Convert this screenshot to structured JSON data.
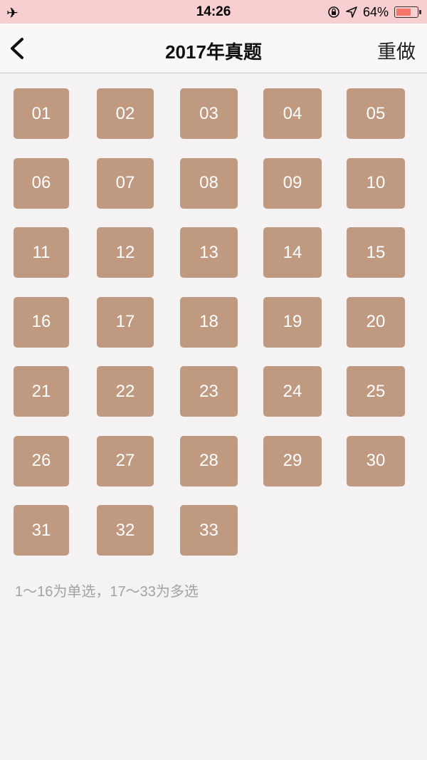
{
  "status_bar": {
    "time": "14:26",
    "battery_percent": "64%",
    "battery_level": 0.64,
    "icons": [
      "airplane-icon",
      "orientation-lock-icon",
      "location-arrow-icon",
      "battery-icon"
    ]
  },
  "nav": {
    "title": "2017年真题",
    "back_icon": "chevron-left-icon",
    "redo_label": "重做"
  },
  "questions": [
    "01",
    "02",
    "03",
    "04",
    "05",
    "06",
    "07",
    "08",
    "09",
    "10",
    "11",
    "12",
    "13",
    "14",
    "15",
    "16",
    "17",
    "18",
    "19",
    "20",
    "21",
    "22",
    "23",
    "24",
    "25",
    "26",
    "27",
    "28",
    "29",
    "30",
    "31",
    "32",
    "33"
  ],
  "note": "1～16为单选，17～33为多选",
  "colors": {
    "status_bar": "#f8cfd0",
    "question_button": "#c09a80",
    "background": "#f4f2f3"
  }
}
